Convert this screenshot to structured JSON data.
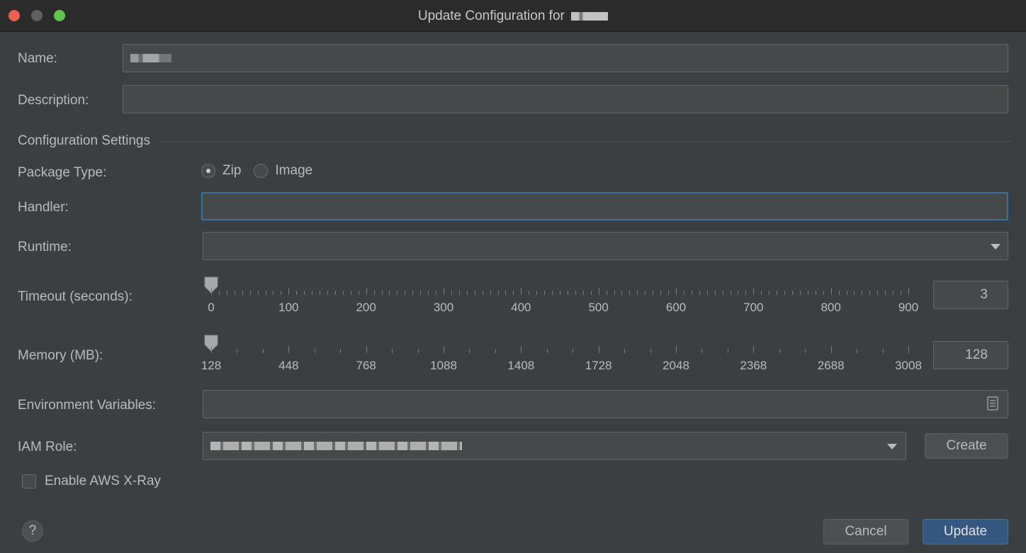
{
  "window": {
    "title": "Update Configuration for"
  },
  "form": {
    "name_label": "Name:",
    "description_label": "Description:",
    "section_title": "Configuration Settings",
    "package_type_label": "Package Type:",
    "package_options": [
      "Zip",
      "Image"
    ],
    "package_selected": "Zip",
    "handler_label": "Handler:",
    "handler_value": "",
    "runtime_label": "Runtime:",
    "runtime_value": "",
    "timeout_label": "Timeout (seconds):",
    "timeout_value": "3",
    "timeout_ticks": [
      "0",
      "100",
      "200",
      "300",
      "400",
      "500",
      "600",
      "700",
      "800",
      "900"
    ],
    "memory_label": "Memory (MB):",
    "memory_value": "128",
    "memory_ticks": [
      "128",
      "448",
      "768",
      "1088",
      "1408",
      "1728",
      "2048",
      "2368",
      "2688",
      "3008"
    ],
    "env_label": "Environment Variables:",
    "iam_label": "IAM Role:",
    "create_label": "Create",
    "xray_label": "Enable AWS X-Ray",
    "xray_checked": false
  },
  "footer": {
    "help_label": "?",
    "cancel_label": "Cancel",
    "update_label": "Update"
  },
  "colors": {
    "accent": "#365880",
    "focus": "#3b6fa0",
    "close": "#ed5e55",
    "maximize": "#62c34d"
  }
}
